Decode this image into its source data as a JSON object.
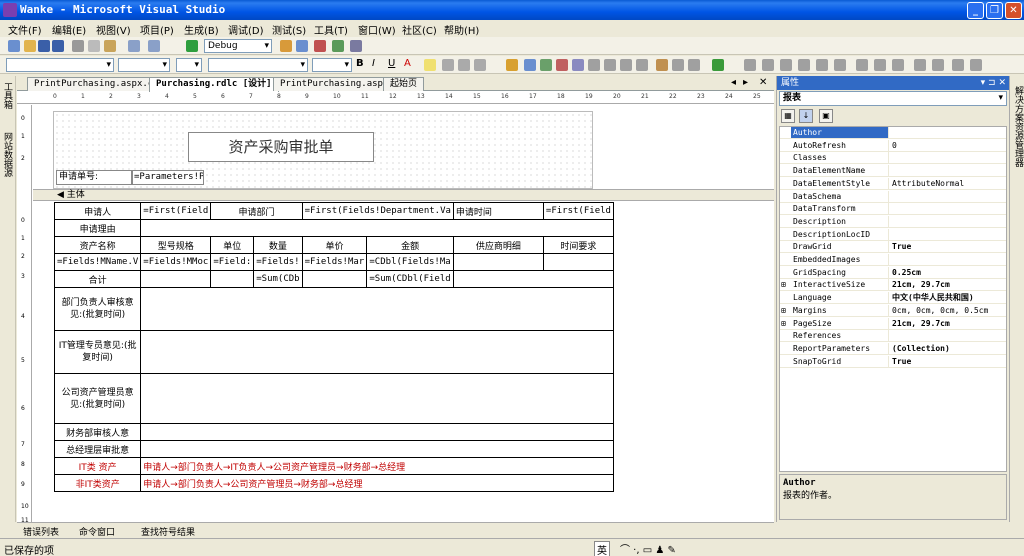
{
  "window": {
    "title": "Wanke - Microsoft Visual Studio"
  },
  "menu": [
    "文件(F)",
    "编辑(E)",
    "视图(V)",
    "项目(P)",
    "生成(B)",
    "调试(D)",
    "测试(S)",
    "工具(T)",
    "窗口(W)",
    "社区(C)",
    "帮助(H)"
  ],
  "toolbar": {
    "config": "Debug"
  },
  "left_strip": {
    "toolbox": "工具箱",
    "datasource": "网站数据源"
  },
  "right_strip": {
    "solution": "解决方案资源管理器"
  },
  "tabs": [
    {
      "label": "PrintPurchasing.aspx.cs"
    },
    {
      "label": "Purchasing.rdlc [设计]"
    },
    {
      "label": "PrintPurchasing.aspx"
    },
    {
      "label": "起始页"
    }
  ],
  "ruler": [
    "0",
    "1",
    "2",
    "3",
    "4",
    "5",
    "6",
    "7",
    "8",
    "9",
    "10",
    "11",
    "12",
    "13",
    "14",
    "15",
    "16",
    "17",
    "18",
    "19",
    "20",
    "21",
    "22",
    "23",
    "24",
    "25"
  ],
  "vruler": [
    "0",
    "1",
    "2",
    "0",
    "1",
    "2",
    "3",
    "4",
    "5",
    "6",
    "7",
    "8",
    "9",
    "10",
    "11"
  ],
  "report": {
    "title": "资产采购审批单",
    "form_no_label": "申请单号:",
    "form_no_value": "=Parameters!P",
    "body_label": "主体",
    "rows": {
      "applicant": "申请人",
      "applicant_val": "=First(Field",
      "dept": "申请部门",
      "dept_val": "=First(Fields!Department.Va",
      "time": "申请时间",
      "time_val": "=First(Field",
      "reason": "申请理由",
      "h_name": "资产名称",
      "h_model": "型号规格",
      "h_unit": "单位",
      "h_qty": "数量",
      "h_price": "单价",
      "h_amount": "金额",
      "h_supplier": "供应商明细",
      "h_time": "时间要求",
      "d_name": "=Fields!MName.V",
      "d_model": "=Fields!MMoc",
      "d_unit": "=Field:",
      "d_qty": "=Fields!",
      "d_price": "=Fields!Mar",
      "d_amount": "=CDbl(Fields!Ma",
      "total": "合计",
      "total_qty": "=Sum(CDb",
      "total_amount": "=Sum(CDbl(Field",
      "dept_head": "部门负责人审核意见:(批复时间)",
      "it_admin": "IT管理专员意见:(批复时间)",
      "asset_admin": "公司资产管理员意见:(批复时间)",
      "finance": "财务部审核人意",
      "gm": "总经理层审批意",
      "it_type": "IT类 资产",
      "it_flow": "申请人→部门负责人→IT负责人→公司资产管理员→财务部→总经理",
      "nonit_type": "非IT类资产",
      "nonit_flow": "申请人→部门负责人→公司资产管理员→财务部→总经理"
    }
  },
  "properties": {
    "panel_title": "属性",
    "object": "报表",
    "rows": [
      {
        "name": "Author",
        "value": "",
        "exp": "",
        "bold": false,
        "sel": true
      },
      {
        "name": "AutoRefresh",
        "value": "0",
        "exp": "",
        "bold": false
      },
      {
        "name": "Classes",
        "value": "",
        "exp": "",
        "bold": false
      },
      {
        "name": "DataElementName",
        "value": "",
        "exp": "",
        "bold": false
      },
      {
        "name": "DataElementStyle",
        "value": "AttributeNormal",
        "exp": "",
        "bold": false
      },
      {
        "name": "DataSchema",
        "value": "",
        "exp": "",
        "bold": false
      },
      {
        "name": "DataTransform",
        "value": "",
        "exp": "",
        "bold": false
      },
      {
        "name": "Description",
        "value": "",
        "exp": "",
        "bold": false
      },
      {
        "name": "DescriptionLocID",
        "value": "",
        "exp": "",
        "bold": false
      },
      {
        "name": "DrawGrid",
        "value": "True",
        "exp": "",
        "bold": true
      },
      {
        "name": "EmbeddedImages",
        "value": "",
        "exp": "",
        "bold": false
      },
      {
        "name": "GridSpacing",
        "value": "0.25cm",
        "exp": "",
        "bold": true
      },
      {
        "name": "InteractiveSize",
        "value": "21cm, 29.7cm",
        "exp": "+",
        "bold": true
      },
      {
        "name": "Language",
        "value": "中文(中华人民共和国)",
        "exp": "",
        "bold": true
      },
      {
        "name": "Margins",
        "value": "0cm, 0cm, 0cm, 0.5cm",
        "exp": "+",
        "bold": false
      },
      {
        "name": "PageSize",
        "value": "21cm, 29.7cm",
        "exp": "+",
        "bold": true
      },
      {
        "name": "References",
        "value": "",
        "exp": "",
        "bold": false
      },
      {
        "name": "ReportParameters",
        "value": "(Collection)",
        "exp": "",
        "bold": true
      },
      {
        "name": "SnapToGrid",
        "value": "True",
        "exp": "",
        "bold": true
      }
    ],
    "desc_name": "Author",
    "desc_text": "报表的作者。"
  },
  "bottom_tabs": [
    "错误列表",
    "命令窗口",
    "查找符号结果"
  ],
  "status": {
    "text": "已保存的项",
    "ime": "英"
  }
}
